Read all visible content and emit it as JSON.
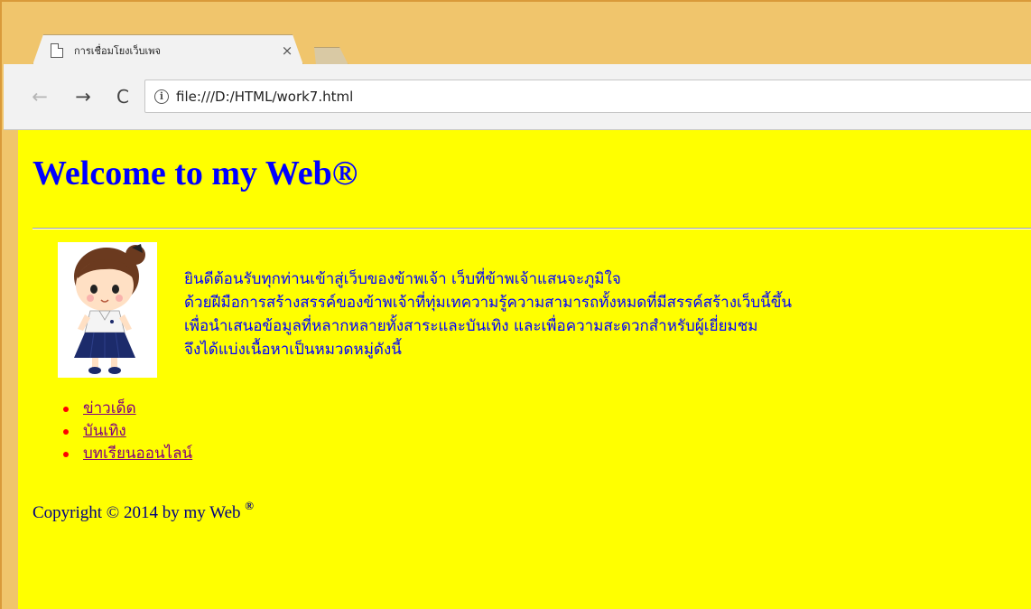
{
  "browser": {
    "tab": {
      "title": "การเชื่อมโยงเว็บเพจ",
      "close_glyph": "×"
    },
    "nav": {
      "back_glyph": "←",
      "forward_glyph": "→",
      "reload_glyph": "C"
    },
    "address_bar": {
      "info_glyph": "i",
      "url": "file:///D:/HTML/work7.html"
    }
  },
  "page": {
    "background_color": "#ffff00",
    "heading": "Welcome to my Web®",
    "heading_color": "#0000ff",
    "intro_lines": [
      "ยินดีต้อนรับทุกท่านเข้าสู่เว็บของข้าพเจ้า เว็บที่ข้าพเจ้าแสนจะภูมิใจ",
      "ด้วยฝีมือการสร้างสรรค์ของข้าพเจ้าที่ทุ่มเทความรู้ความสามารถทั้งหมดที่มีสรรค์สร้างเว็บนี้ขึ้น",
      "เพื่อนำเสนอข้อมูลที่หลากหลายทั้งสาระและบันเทิง และเพื่อความสะดวกสำหรับผู้เยี่ยมชม",
      "จึงได้แบ่งเนื้อหาเป็นหมวดหมู่ดังนี้"
    ],
    "links": [
      {
        "label": "ข่าวเด็ด"
      },
      {
        "label": "บันเทิง"
      },
      {
        "label": "บทเรียนออนไลน์"
      }
    ],
    "footer": {
      "text": "Copyright © 2014 by my Web ",
      "mark": "®"
    }
  }
}
